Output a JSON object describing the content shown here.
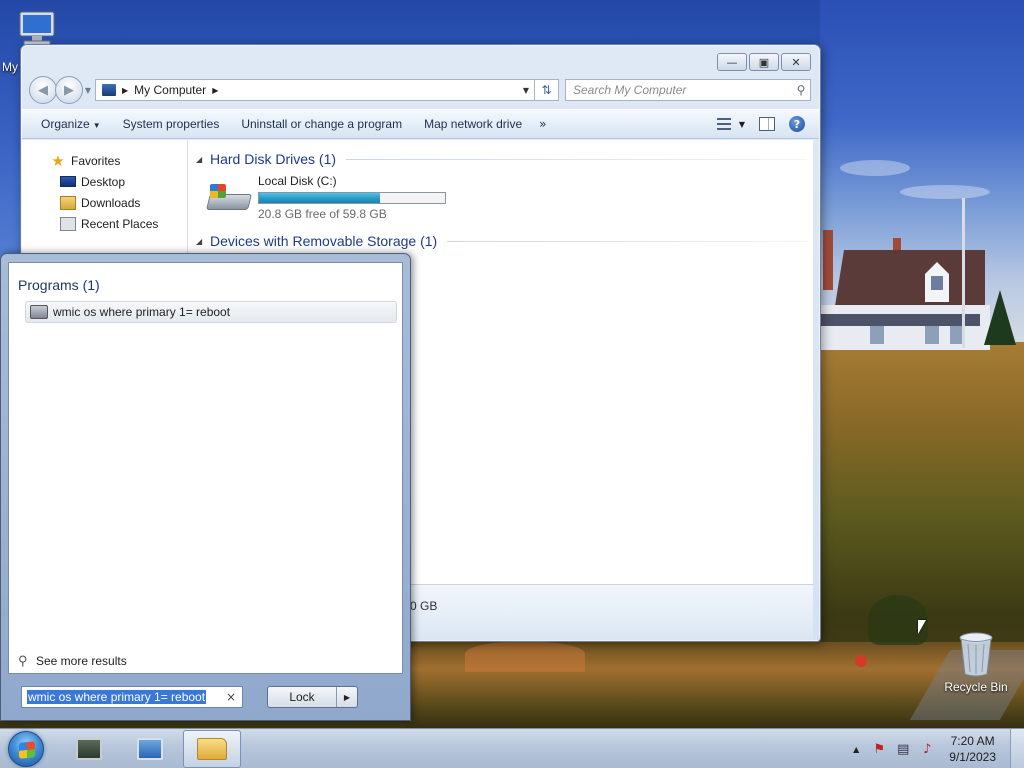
{
  "desktop": {
    "icons": [
      {
        "label": "My",
        "icon": "my-computer-icon"
      },
      {
        "label": "Recycle Bin",
        "icon": "recycle-bin-icon"
      }
    ]
  },
  "explorer": {
    "caption_buttons": [
      "minimize",
      "maximize",
      "close"
    ],
    "address": {
      "location": "My Computer"
    },
    "search": {
      "placeholder": "Search My Computer"
    },
    "commands": [
      {
        "label": "Organize",
        "dropdown": true
      },
      {
        "label": "System properties"
      },
      {
        "label": "Uninstall or change a program"
      },
      {
        "label": "Map network drive"
      }
    ],
    "more_commands": "»",
    "nav": {
      "favorites_label": "Favorites",
      "items": [
        "Desktop",
        "Downloads",
        "Recent Places"
      ]
    },
    "groups": [
      {
        "title": "Hard Disk Drives (1)"
      },
      {
        "title": "Devices with Removable Storage (1)"
      }
    ],
    "drive": {
      "name": "Local Disk (C:)",
      "free_text": "20.8 GB free of 59.8 GB",
      "used_fraction": 0.65
    },
    "details_text": "0 GB"
  },
  "start_menu": {
    "programs_header": "Programs (1)",
    "results": [
      "wmic os where primary 1= reboot"
    ],
    "see_more": "See more results",
    "search_value": "wmic os where primary 1= reboot",
    "clear_symbol": "×",
    "lock_label": "Lock"
  },
  "taskbar": {
    "pinned": [
      "task-manager",
      "control-panel",
      "windows-explorer"
    ],
    "time": "7:20 AM",
    "date": "9/1/2023"
  },
  "colors": {
    "accent": "#1e3a8a",
    "drive_bar": "#2a9cc8",
    "selection": "#3a78d8"
  }
}
